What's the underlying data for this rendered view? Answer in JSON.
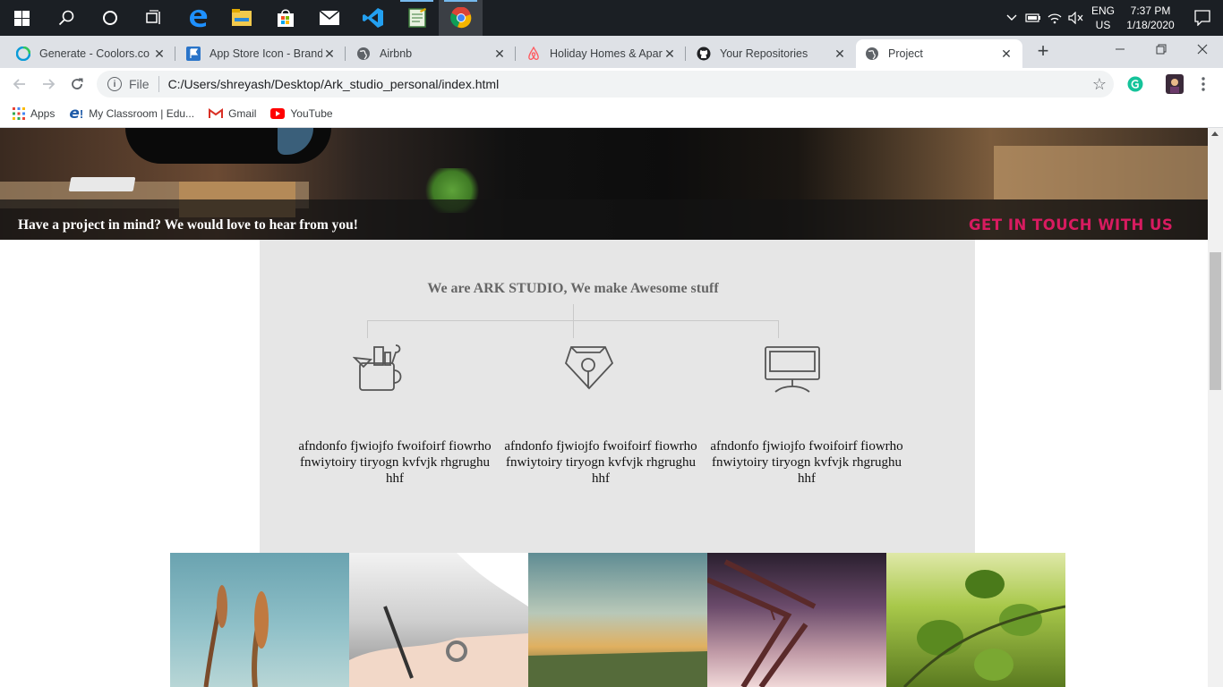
{
  "taskbar": {
    "icons": [
      "windows-start-icon",
      "search-icon",
      "cortana-icon",
      "task-view-icon",
      "edge-icon",
      "file-explorer-icon",
      "store-icon",
      "mail-icon",
      "vscode-icon",
      "notepad-icon",
      "chrome-icon"
    ],
    "lang_line1": "ENG",
    "lang_line2": "US",
    "time": "7:37 PM",
    "date": "1/18/2020"
  },
  "tabs": [
    {
      "title": "Generate - Coolors.co",
      "icon": "coolors-icon",
      "color": "#0aa"
    },
    {
      "title": "App Store Icon - Brands",
      "icon": "flag-icon",
      "color": "#2a74c9"
    },
    {
      "title": "Airbnb",
      "icon": "globe-icon",
      "color": "#5f6368"
    },
    {
      "title": "Holiday Homes & Apartments",
      "icon": "airbnb-icon",
      "color": "#ff5a5f"
    },
    {
      "title": "Your Repositories",
      "icon": "github-icon",
      "color": "#202124"
    },
    {
      "title": "Project",
      "icon": "globe-icon",
      "color": "#5f6368"
    }
  ],
  "toolbar": {
    "scheme": "File",
    "url": "C:/Users/shreyash/Desktop/Ark_studio_personal/index.html"
  },
  "bookmarks": [
    {
      "label": "Apps",
      "icon": "apps-grid-icon"
    },
    {
      "label": "My Classroom | Edu...",
      "icon": "edureka-icon"
    },
    {
      "label": "Gmail",
      "icon": "gmail-icon"
    },
    {
      "label": "YouTube",
      "icon": "youtube-icon"
    }
  ],
  "hero": {
    "tagline": "Have a project in mind? We would love to hear from you!",
    "cta": "GET IN TOUCH WITH US",
    "cta_color": "#d81b60"
  },
  "about": {
    "title": "We are ARK STUDIO, We make Awesome stuff",
    "services": [
      {
        "icon": "design-tools-icon",
        "text": "afndonfo fjwiojfo fwoifoirf fiowrho fnwiytoiry tiryogn kvfvjk rhgrughu hhf"
      },
      {
        "icon": "pen-nib-icon",
        "text": "afndonfo fjwiojfo fwoifoirf fiowrho fnwiytoiry tiryogn kvfvjk rhgrughu hhf"
      },
      {
        "icon": "monitor-icon",
        "text": "afndonfo fjwiojfo fwoifoirf fiowrho fnwiytoiry tiryogn kvfvjk rhgrughu hhf"
      }
    ]
  },
  "gallery": [
    "wheat-photo",
    "writing-hand-photo",
    "field-sunset-photo",
    "bridge-photo",
    "leaves-photo"
  ]
}
